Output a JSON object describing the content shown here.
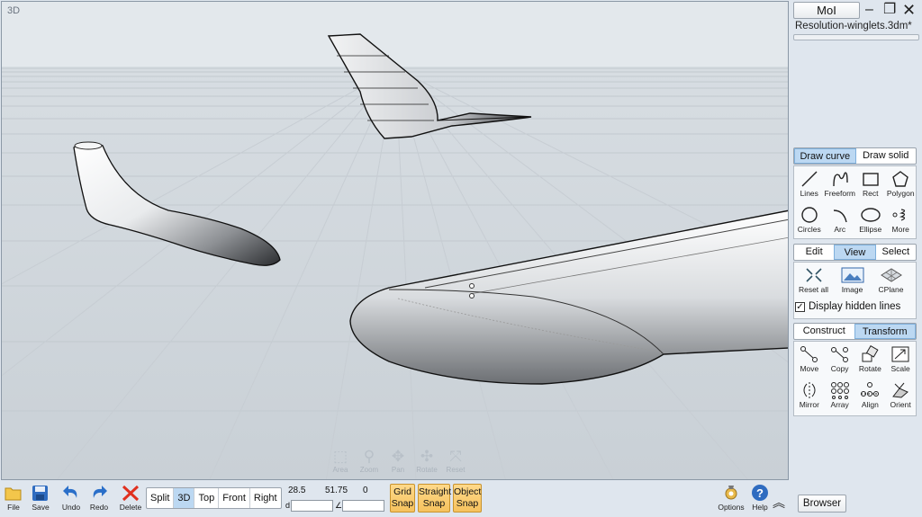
{
  "viewport": {
    "label": "3D",
    "nav_tools": [
      {
        "label": "Area",
        "icon": "area-zoom-icon"
      },
      {
        "label": "Zoom",
        "icon": "zoom-icon"
      },
      {
        "label": "Pan",
        "icon": "pan-icon"
      },
      {
        "label": "Rotate",
        "icon": "rotate-icon"
      },
      {
        "label": "Reset",
        "icon": "reset-view-icon"
      }
    ]
  },
  "panel": {
    "app_button": "MoI",
    "filename": "Resolution-winglets.3dm*",
    "draw_tabs": [
      "Draw curve",
      "Draw solid"
    ],
    "draw_tools": [
      "Lines",
      "Freeform",
      "Rect",
      "Polygon",
      "Circles",
      "Arc",
      "Ellipse",
      "More"
    ],
    "view_tabs": [
      "Edit",
      "View",
      "Select"
    ],
    "view_tools": [
      "Reset all",
      "Image",
      "CPlane"
    ],
    "hidden_lines_label": "Display hidden lines",
    "hidden_lines_checked": true,
    "transform_tabs": [
      "Construct",
      "Transform"
    ],
    "transform_tools": [
      "Move",
      "Copy",
      "Rotate",
      "Scale",
      "Mirror",
      "Array",
      "Align",
      "Orient"
    ],
    "browser_label": "Browser"
  },
  "bottom": {
    "file": "File",
    "save": "Save",
    "undo": "Undo",
    "redo": "Redo",
    "delete": "Delete",
    "views": [
      "Split",
      "3D",
      "Top",
      "Front",
      "Right"
    ],
    "active_view": "3D",
    "coords": {
      "x": "28.5",
      "y": "51.75",
      "z": "0",
      "d_label": "d",
      "angle_label": "∠"
    },
    "snaps": [
      {
        "line1": "Grid",
        "line2": "Snap"
      },
      {
        "line1": "Straight",
        "line2": "Snap"
      },
      {
        "line1": "Object",
        "line2": "Snap"
      }
    ],
    "options": "Options",
    "help": "Help"
  },
  "colors": {
    "accent": "#bcd8f2",
    "snap": "#f6c25e",
    "delete": "#e0301e",
    "undo_redo": "#2a6fc9"
  }
}
